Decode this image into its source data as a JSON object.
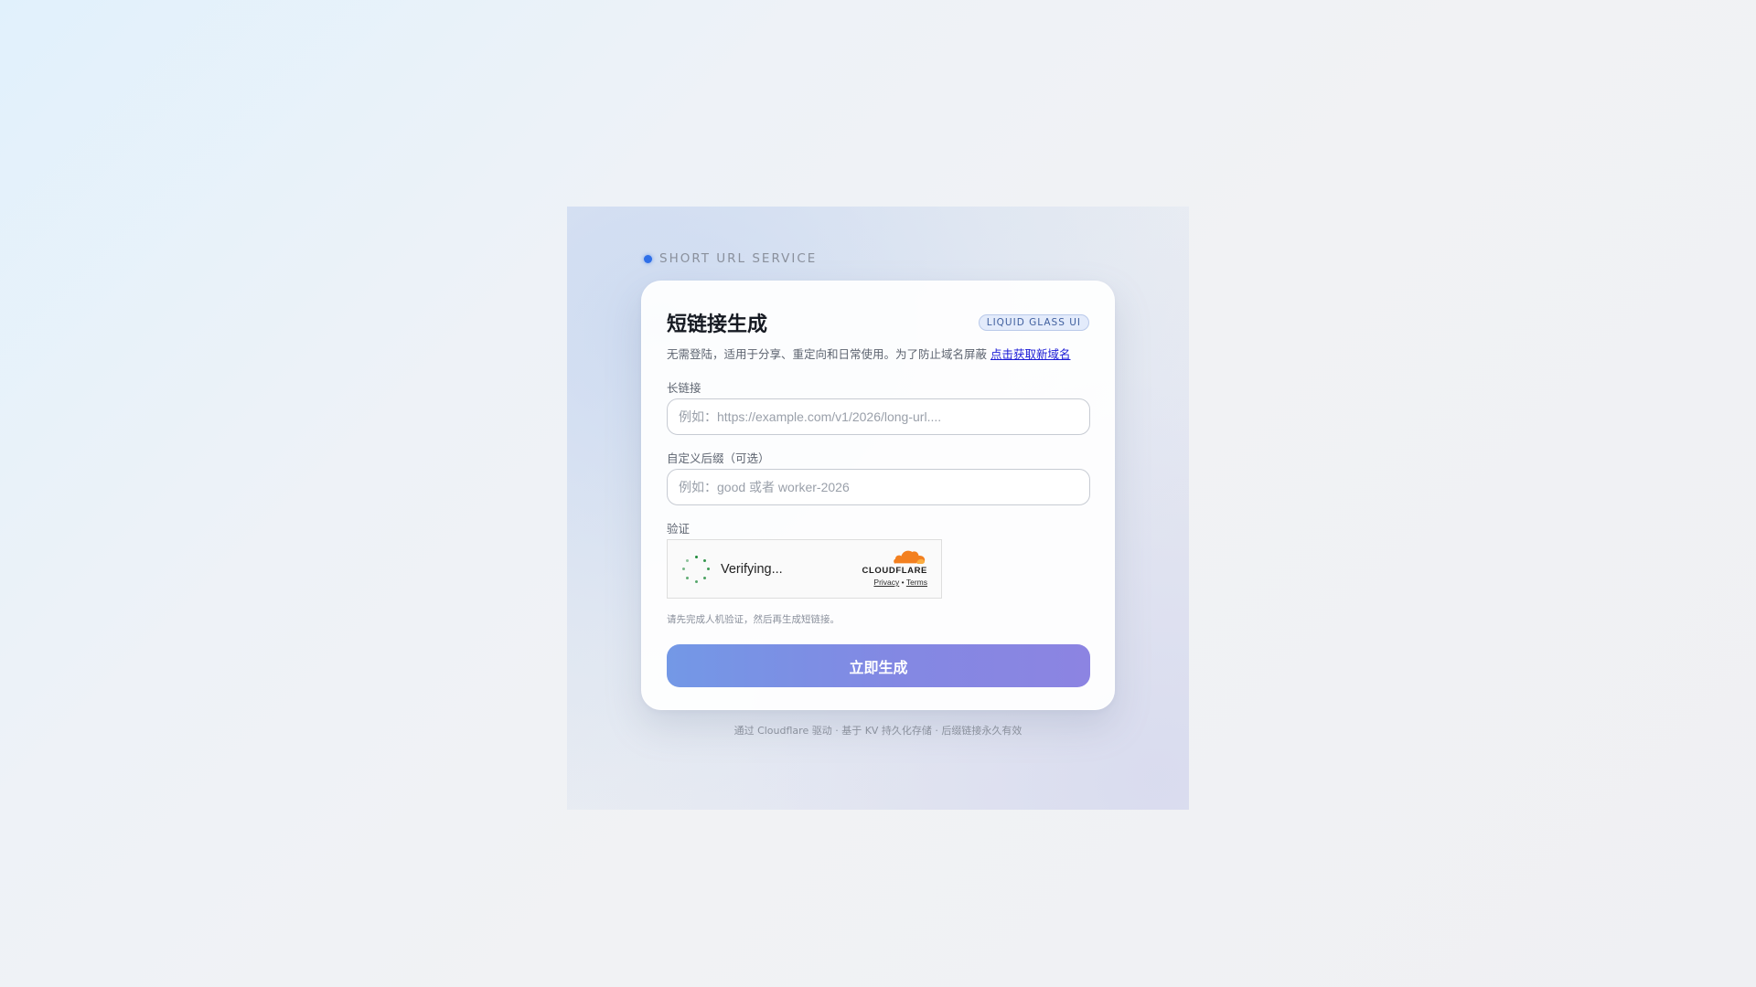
{
  "brand": {
    "label": "SHORT URL SERVICE"
  },
  "card": {
    "title": "短链接生成",
    "badge": "LIQUID GLASS UI",
    "subtitle": "无需登陆，适用于分享、重定向和日常使用。为了防止域名屏蔽 ",
    "subtitle_link": "点击获取新域名"
  },
  "form": {
    "long_url": {
      "label": "长链接",
      "placeholder": "例如：https://example.com/v1/2026/long-url....",
      "value": ""
    },
    "suffix": {
      "label": "自定义后缀（可选）",
      "placeholder": "例如：good 或者 worker-2026",
      "value": ""
    },
    "verify": {
      "label": "验证"
    },
    "hint": "请先完成人机验证，然后再生成短链接。",
    "submit_label": "立即生成"
  },
  "turnstile": {
    "status": "Verifying...",
    "provider": "CLOUDFLARE",
    "privacy_label": "Privacy",
    "separator": "•",
    "terms_label": "Terms"
  },
  "footer": {
    "text": "通过 Cloudflare 驱动 · 基于 KV 持久化存储 · 后缀链接永久有效"
  },
  "colors": {
    "accent": "#2f6fe8",
    "button_start": "#7398e6",
    "button_end": "#8c84e2",
    "cloudflare_orange": "#f38020",
    "spinner_green": "#1f8b3b"
  }
}
